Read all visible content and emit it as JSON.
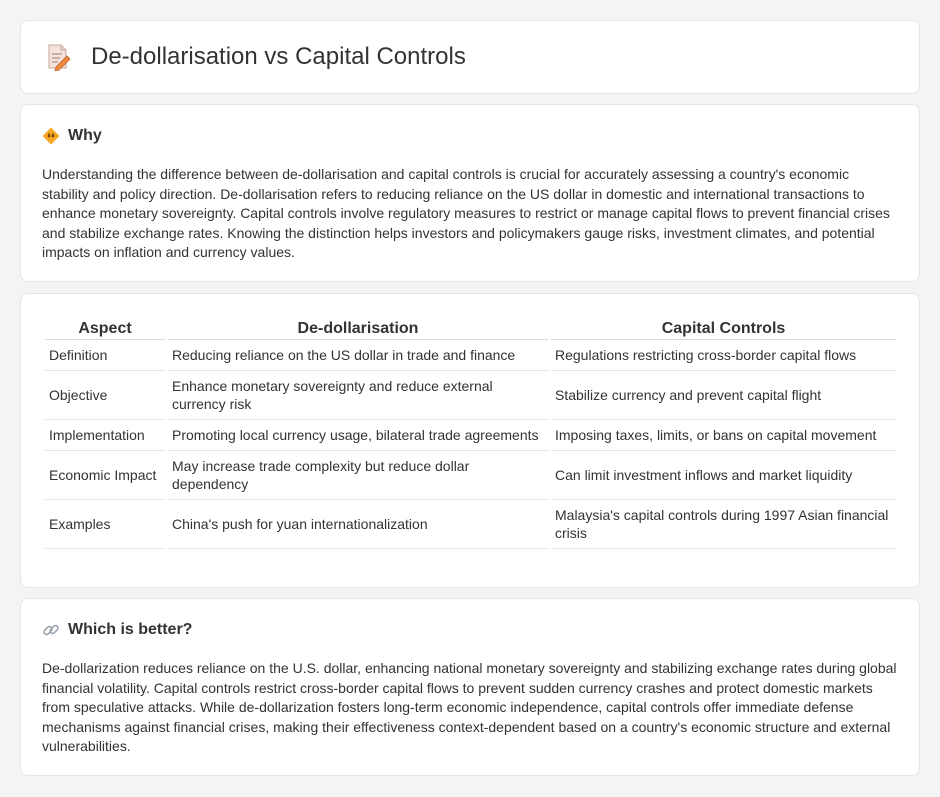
{
  "header": {
    "title": "De-dollarisation vs Capital Controls",
    "icon": "document-pencil-icon"
  },
  "why": {
    "title": "Why",
    "icon": "diamond-icon",
    "body": "Understanding the difference between de-dollarisation and capital controls is crucial for accurately assessing a country's economic stability and policy direction. De-dollarisation refers to reducing reliance on the US dollar in domestic and international transactions to enhance monetary sovereignty. Capital controls involve regulatory measures to restrict or manage capital flows to prevent financial crises and stabilize exchange rates. Knowing the distinction helps investors and policymakers gauge risks, investment climates, and potential impacts on inflation and currency values."
  },
  "table": {
    "headers": [
      "Aspect",
      "De-dollarisation",
      "Capital Controls"
    ],
    "rows": [
      [
        "Definition",
        "Reducing reliance on the US dollar in trade and finance",
        "Regulations restricting cross-border capital flows"
      ],
      [
        "Objective",
        "Enhance monetary sovereignty and reduce external currency risk",
        "Stabilize currency and prevent capital flight"
      ],
      [
        "Implementation",
        "Promoting local currency usage, bilateral trade agreements",
        "Imposing taxes, limits, or bans on capital movement"
      ],
      [
        "Economic Impact",
        "May increase trade complexity but reduce dollar dependency",
        "Can limit investment inflows and market liquidity"
      ],
      [
        "Examples",
        "China's push for yuan internationalization",
        "Malaysia's capital controls during 1997 Asian financial crisis"
      ]
    ]
  },
  "better": {
    "title": "Which is better?",
    "icon": "link-icon",
    "body": "De-dollarization reduces reliance on the U.S. dollar, enhancing national monetary sovereignty and stabilizing exchange rates during global financial volatility. Capital controls restrict cross-border capital flows to prevent sudden currency crashes and protect domestic markets from speculative attacks. While de-dollarization fosters long-term economic independence, capital controls offer immediate defense mechanisms against financial crises, making their effectiveness context-dependent based on a country's economic structure and external vulnerabilities."
  }
}
